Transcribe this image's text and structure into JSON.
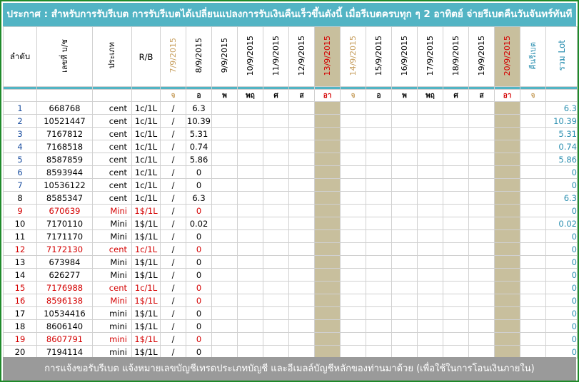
{
  "banner": "ประกาศ : สำหรับการรับรีเบต  การรับรีเบตได้เปลี่ยนแปลงการรับเงินคืนเร็วขึ้นดังนี้   เมื่อรีเบตครบทุก ๆ 2 อาทิตย์ จ่ายรีเบตคืนวันจันทร์ทันที",
  "headers": {
    "index": "ลำดับ",
    "account": "เลขที่ บ/ช",
    "type": "ประเภท",
    "rb": "R/B",
    "rebate_col": "คืนรีเบต",
    "total_lot": "รวม Lot"
  },
  "dates": [
    {
      "label": "7/9/2015",
      "day": "จ",
      "color": "#c8a060",
      "shade": false
    },
    {
      "label": "8/9/2015",
      "day": "อ",
      "color": "#000000",
      "shade": false
    },
    {
      "label": "9/9/2015",
      "day": "พ",
      "color": "#000000",
      "shade": false
    },
    {
      "label": "10/9/2015",
      "day": "พฤ",
      "color": "#000000",
      "shade": false
    },
    {
      "label": "11/9/2015",
      "day": "ศ",
      "color": "#000000",
      "shade": false
    },
    {
      "label": "12/9/2015",
      "day": "ส",
      "color": "#000000",
      "shade": false
    },
    {
      "label": "13/9/2015",
      "day": "อา",
      "color": "#d40000",
      "shade": true
    },
    {
      "label": "14/9/2015",
      "day": "จ",
      "color": "#c8a060",
      "shade": false
    },
    {
      "label": "15/9/2015",
      "day": "อ",
      "color": "#000000",
      "shade": false
    },
    {
      "label": "16/9/2015",
      "day": "พ",
      "color": "#000000",
      "shade": false
    },
    {
      "label": "17/9/2015",
      "day": "พฤ",
      "color": "#000000",
      "shade": false
    },
    {
      "label": "18/9/2015",
      "day": "ศ",
      "color": "#000000",
      "shade": false
    },
    {
      "label": "19/9/2015",
      "day": "ส",
      "color": "#000000",
      "shade": false
    },
    {
      "label": "20/9/2015",
      "day": "อา",
      "color": "#d40000",
      "shade": true
    }
  ],
  "rebate_day": "จ",
  "rows": [
    {
      "no": "1",
      "account": "668768",
      "type": "cent",
      "rb": "1c/1L",
      "slash": "/",
      "mon": "6.3",
      "total": "6.3",
      "style": "blue"
    },
    {
      "no": "2",
      "account": "10521447",
      "type": "cent",
      "rb": "1c/1L",
      "slash": "/",
      "mon": "10.39",
      "total": "10.39",
      "style": "blue"
    },
    {
      "no": "3",
      "account": "7167812",
      "type": "cent",
      "rb": "1c/1L",
      "slash": "/",
      "mon": "5.31",
      "total": "5.31",
      "style": "blue"
    },
    {
      "no": "4",
      "account": "7168518",
      "type": "cent",
      "rb": "1c/1L",
      "slash": "/",
      "mon": "0.74",
      "total": "0.74",
      "style": "blue"
    },
    {
      "no": "5",
      "account": "8587859",
      "type": "cent",
      "rb": "1c/1L",
      "slash": "/",
      "mon": "5.86",
      "total": "5.86",
      "style": "blue"
    },
    {
      "no": "6",
      "account": "8593944",
      "type": "cent",
      "rb": "1c/1L",
      "slash": "/",
      "mon": "0",
      "total": "0",
      "style": "blue"
    },
    {
      "no": "7",
      "account": "10536122",
      "type": "cent",
      "rb": "1c/1L",
      "slash": "/",
      "mon": "0",
      "total": "0",
      "style": "blue"
    },
    {
      "no": "8",
      "account": "8585347",
      "type": "cent",
      "rb": "1c/1L",
      "slash": "/",
      "mon": "6.3",
      "total": "6.3",
      "style": "black"
    },
    {
      "no": "9",
      "account": "670639",
      "type": "Mini",
      "rb": "1$/1L",
      "slash": "/",
      "mon": "0",
      "total": "0",
      "style": "red"
    },
    {
      "no": "10",
      "account": "7170110",
      "type": "Mini",
      "rb": "1$/1L",
      "slash": "/",
      "mon": "0.02",
      "total": "0.02",
      "style": "black"
    },
    {
      "no": "11",
      "account": "7171170",
      "type": "Mini",
      "rb": "1$/1L",
      "slash": "/",
      "mon": "0",
      "total": "0",
      "style": "black"
    },
    {
      "no": "12",
      "account": "7172130",
      "type": "cent",
      "rb": "1c/1L",
      "slash": "/",
      "mon": "0",
      "total": "0",
      "style": "red"
    },
    {
      "no": "13",
      "account": "673984",
      "type": "Mini",
      "rb": "1$/1L",
      "slash": "/",
      "mon": "0",
      "total": "0",
      "style": "black"
    },
    {
      "no": "14",
      "account": "626277",
      "type": "Mini",
      "rb": "1$/1L",
      "slash": "/",
      "mon": "0",
      "total": "0",
      "style": "black"
    },
    {
      "no": "15",
      "account": "7176988",
      "type": "cent",
      "rb": "1c/1L",
      "slash": "/",
      "mon": "0",
      "total": "0",
      "style": "red"
    },
    {
      "no": "16",
      "account": "8596138",
      "type": "Mini",
      "rb": "1$/1L",
      "slash": "/",
      "mon": "0",
      "total": "0",
      "style": "red"
    },
    {
      "no": "17",
      "account": "10534416",
      "type": "mini",
      "rb": "1$/1L",
      "slash": "/",
      "mon": "0",
      "total": "0",
      "style": "black"
    },
    {
      "no": "18",
      "account": "8606140",
      "type": "mini",
      "rb": "1$/1L",
      "slash": "/",
      "mon": "0",
      "total": "0",
      "style": "black"
    },
    {
      "no": "19",
      "account": "8607791",
      "type": "mini",
      "rb": "1$/1L",
      "slash": "/",
      "mon": "0",
      "total": "0",
      "style": "red"
    },
    {
      "no": "20",
      "account": "7194114",
      "type": "mini",
      "rb": "1$/1L",
      "slash": "/",
      "mon": "0",
      "total": "0",
      "style": "black"
    }
  ],
  "footer": "การแจ้งขอรับรีเบต  แจ้งหมายเลขบัญชีเทรดประเภทบัญชี และอีเมลล์บัญชีหลักของท่านมาด้วย   (เพื่อใช้ในการโอนเงินภายใน)"
}
